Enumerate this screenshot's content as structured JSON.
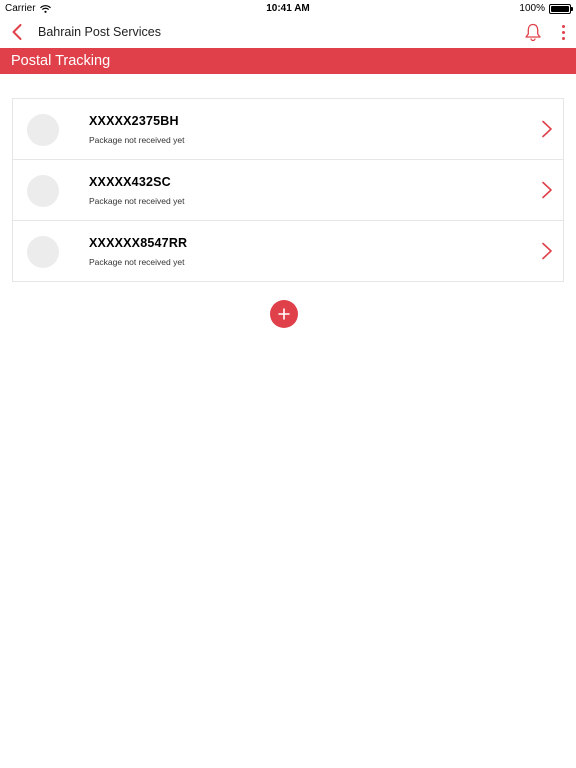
{
  "status_bar": {
    "carrier": "Carrier",
    "time": "10:41 AM",
    "battery": "100%",
    "wifi_icon": "wifi-icon"
  },
  "nav": {
    "title": "Bahrain Post Services",
    "back_icon": "chevron-left-icon",
    "notification_icon": "bell-icon",
    "menu_icon": "more-vertical-icon"
  },
  "section": {
    "title": "Postal Tracking"
  },
  "tracking_items": [
    {
      "code": "XXXXX2375BH",
      "status": "Package not received yet"
    },
    {
      "code": "XXXXX432SC",
      "status": "Package not received yet"
    },
    {
      "code": "XXXXXX8547RR",
      "status": "Package not received yet"
    }
  ],
  "add_button": {
    "icon": "plus-icon"
  },
  "colors": {
    "accent": "#e0404a",
    "avatar_placeholder": "#ececec",
    "divider": "#e6e6e6"
  }
}
